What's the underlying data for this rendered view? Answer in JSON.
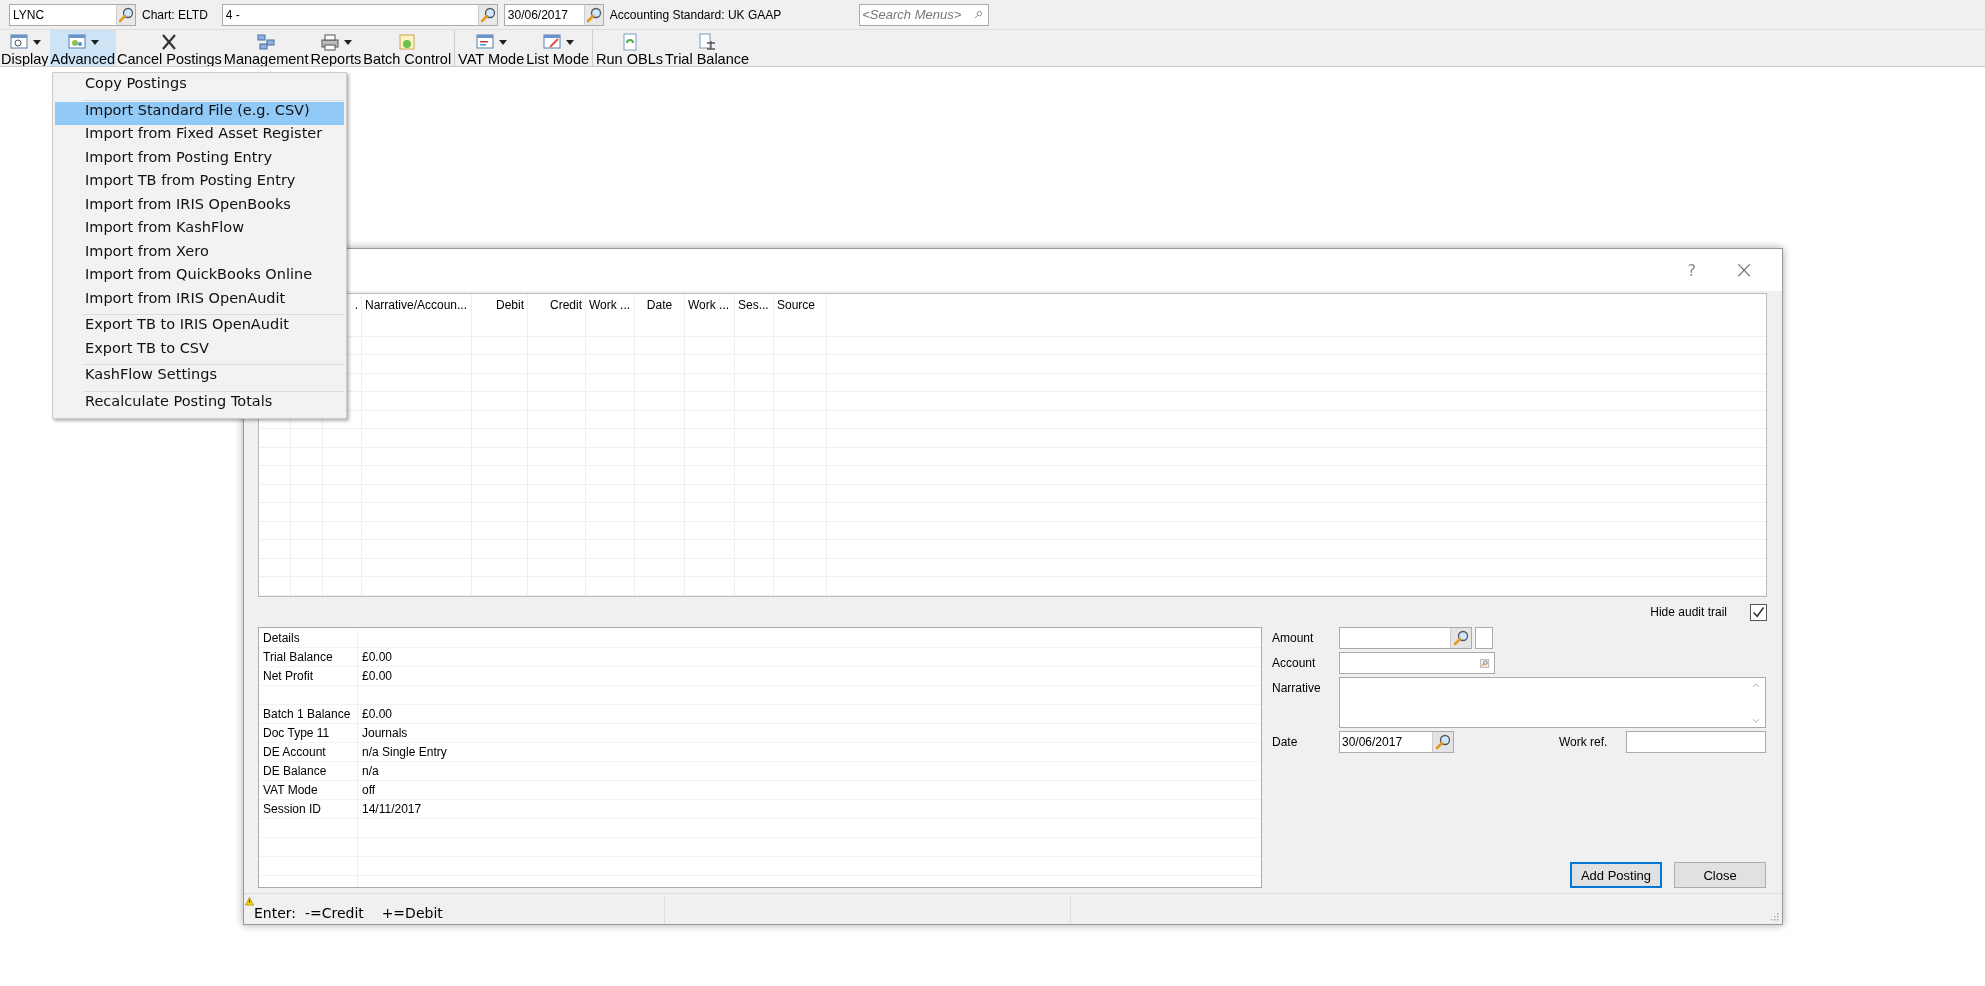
{
  "top_bar": {
    "client_code": "LYNC",
    "chart": "Chart: ELTD",
    "period": "4 -",
    "date": "30/06/2017",
    "standard": "Accounting Standard: UK GAAP",
    "search_menus": {
      "placeholder": "<Search Menus>"
    }
  },
  "toolbar": {
    "groups": [
      [
        {
          "label": "Display",
          "dropdown": true,
          "selected": false
        },
        {
          "label": "Advanced",
          "dropdown": true,
          "selected": true
        },
        {
          "label": "Cancel Postings",
          "dropdown": false,
          "selected": false
        },
        {
          "label": "Management",
          "dropdown": false,
          "selected": false
        },
        {
          "label": "Reports",
          "dropdown": true,
          "selected": false
        },
        {
          "label": "Batch Control",
          "dropdown": false,
          "selected": false
        }
      ],
      [
        {
          "label": "VAT Mode",
          "dropdown": true,
          "selected": false
        },
        {
          "label": "List Mode",
          "dropdown": true,
          "selected": false
        }
      ],
      [
        {
          "label": "Run OBLs",
          "dropdown": false,
          "selected": false
        },
        {
          "label": "Trial Balance",
          "dropdown": false,
          "selected": false
        }
      ]
    ]
  },
  "advanced_menu": {
    "groups": [
      [
        {
          "label": "Copy Postings",
          "selected": false
        }
      ],
      [
        {
          "label": "Import Standard File (e.g. CSV)",
          "selected": true
        },
        {
          "label": "Import from Fixed Asset Register",
          "selected": false
        },
        {
          "label": "Import from Posting Entry",
          "selected": false
        },
        {
          "label": "Import TB from Posting Entry",
          "selected": false
        },
        {
          "label": "Import from IRIS OpenBooks",
          "selected": false
        },
        {
          "label": "Import from KashFlow",
          "selected": false
        },
        {
          "label": "Import from Xero",
          "selected": false
        },
        {
          "label": "Import from QuickBooks Online",
          "selected": false
        },
        {
          "label": "Import from IRIS OpenAudit",
          "selected": false
        }
      ],
      [
        {
          "label": "Export TB to IRIS OpenAudit",
          "selected": false
        },
        {
          "label": "Export TB to CSV",
          "selected": false
        }
      ],
      [
        {
          "label": "KashFlow Settings",
          "selected": false
        }
      ],
      [
        {
          "label": "Recalculate Posting Totals",
          "selected": false
        }
      ]
    ]
  },
  "dialog": {
    "help": "?",
    "close": "×",
    "table": {
      "columns": [
        {},
        {},
        {
          "label": "."
        },
        {
          "label": "Narrative/Accoun..."
        },
        {
          "label": "Debit"
        },
        {
          "label": "Credit"
        },
        {
          "label": "Work ..."
        },
        {
          "label": "Date"
        },
        {
          "label": "Work ..."
        },
        {
          "label": "Ses..."
        },
        {
          "label": "Source"
        }
      ]
    },
    "hide_audit_trail": {
      "label": "Hide audit trail",
      "checked": true
    },
    "details": [
      {
        "kind": "row",
        "label": "Details"
      },
      {
        "kind": "row",
        "label": "Trial Balance",
        "value": "£0.00"
      },
      {
        "kind": "row",
        "label": "Net Profit",
        "value": "£0.00"
      },
      {
        "kind": "blank"
      },
      {
        "kind": "row",
        "label": "Batch 1 Balance",
        "value": "£0.00"
      },
      {
        "kind": "row",
        "label": "Doc Type 11",
        "value": "Journals"
      },
      {
        "kind": "row",
        "label": "DE Account",
        "value": "n/a Single Entry"
      },
      {
        "kind": "row",
        "label": "DE Balance",
        "value": "n/a"
      },
      {
        "kind": "row",
        "label": "VAT Mode",
        "value": "off"
      },
      {
        "kind": "row",
        "label": "Session ID",
        "value": "14/11/2017"
      }
    ],
    "form": {
      "amount": "Amount",
      "account": "Account",
      "narrative": "Narrative",
      "date_label": "Date",
      "date_value": "30/06/2017",
      "work_ref": "Work ref."
    },
    "buttons": [
      {
        "label": "Add Posting",
        "default": true
      },
      {
        "label": "Close",
        "default": false
      }
    ],
    "status_bar": {
      "warning": true,
      "text": "Enter:  -=Credit    +=Debit"
    }
  }
}
